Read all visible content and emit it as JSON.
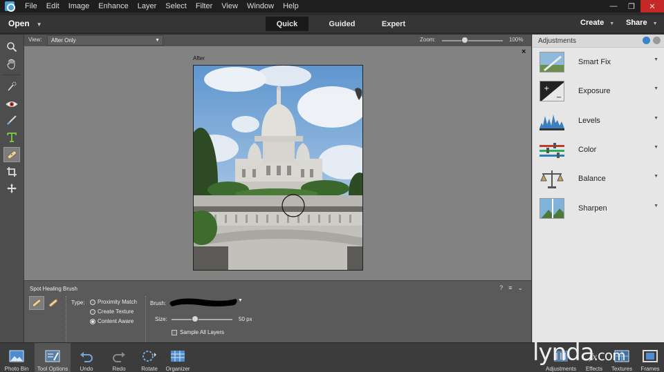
{
  "menu": {
    "items": [
      "File",
      "Edit",
      "Image",
      "Enhance",
      "Layer",
      "Select",
      "Filter",
      "View",
      "Window",
      "Help"
    ]
  },
  "window_controls": {
    "minimize": "—",
    "restore": "❐",
    "close": "✕"
  },
  "modebar": {
    "open_label": "Open",
    "tabs": [
      "Quick",
      "Guided",
      "Expert"
    ],
    "active_tab": "Quick",
    "create_label": "Create",
    "share_label": "Share"
  },
  "viewbar": {
    "view_label": "View:",
    "view_value": "After Only",
    "zoom_label": "Zoom:",
    "zoom_value": "100%",
    "zoom_fraction": 0.38
  },
  "canvas": {
    "after_label": "After",
    "close_label": "×"
  },
  "tool_options": {
    "title": "Spot Healing Brush",
    "type_label": "Type:",
    "types": [
      "Proximity Match",
      "Create Texture",
      "Content Aware"
    ],
    "selected_type": "Content Aware",
    "brush_label": "Brush:",
    "size_label": "Size:",
    "size_value": "50 px",
    "size_fraction": 0.39,
    "sample_all_layers_label": "Sample All Layers",
    "sample_all_layers_checked": false
  },
  "taskbar": {
    "photo_bin": "Photo Bin",
    "tool_options": "Tool Options",
    "undo": "Undo",
    "redo": "Redo",
    "rotate": "Rotate",
    "organizer": "Organizer",
    "adjustments": "Adjustments",
    "effects": "Effects",
    "textures": "Textures",
    "frames": "Frames"
  },
  "adjustments_panel": {
    "title": "Adjustments",
    "items": [
      "Smart Fix",
      "Exposure",
      "Levels",
      "Color",
      "Balance",
      "Sharpen"
    ]
  },
  "watermark": {
    "text": "lynda",
    "suffix": ".com"
  },
  "colors": {
    "menubar": "#1e1e1e",
    "close_button": "#c62828",
    "canvas_bg": "#828282",
    "panel_bg": "#e6e6e6"
  }
}
